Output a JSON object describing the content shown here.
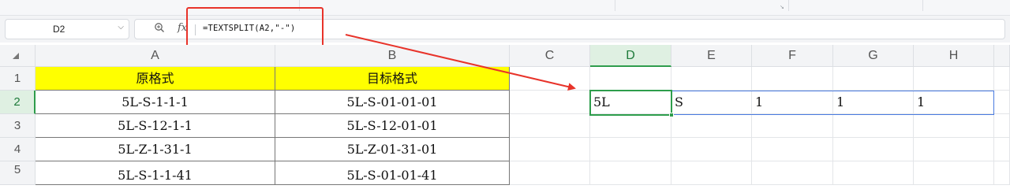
{
  "formula_bar": {
    "name_box": "D2",
    "name_box_dropdown": "⌵",
    "zoom_icon": "🔍",
    "fx_label": "fx",
    "formula": "=TEXTSPLIT(A2,\"-\")"
  },
  "columns": [
    "A",
    "B",
    "C",
    "D",
    "E",
    "F",
    "G",
    "H"
  ],
  "rows": [
    "1",
    "2",
    "3",
    "4",
    "5"
  ],
  "table": {
    "headers": [
      "原格式",
      "目标格式"
    ],
    "rows": [
      [
        "5L-S-1-1-1",
        "5L-S-01-01-01"
      ],
      [
        "5L-S-12-1-1",
        "5L-S-12-01-01"
      ],
      [
        "5L-Z-1-31-1",
        "5L-Z-01-31-01"
      ],
      [
        "5L-S-1-1-41",
        "5L-S-01-01-41"
      ]
    ]
  },
  "spill_result": [
    "5L",
    "S",
    "1",
    "1",
    "1"
  ],
  "selected_cell": "D2",
  "annotation_color": "#e8332a",
  "accent": "#2e9d4c"
}
